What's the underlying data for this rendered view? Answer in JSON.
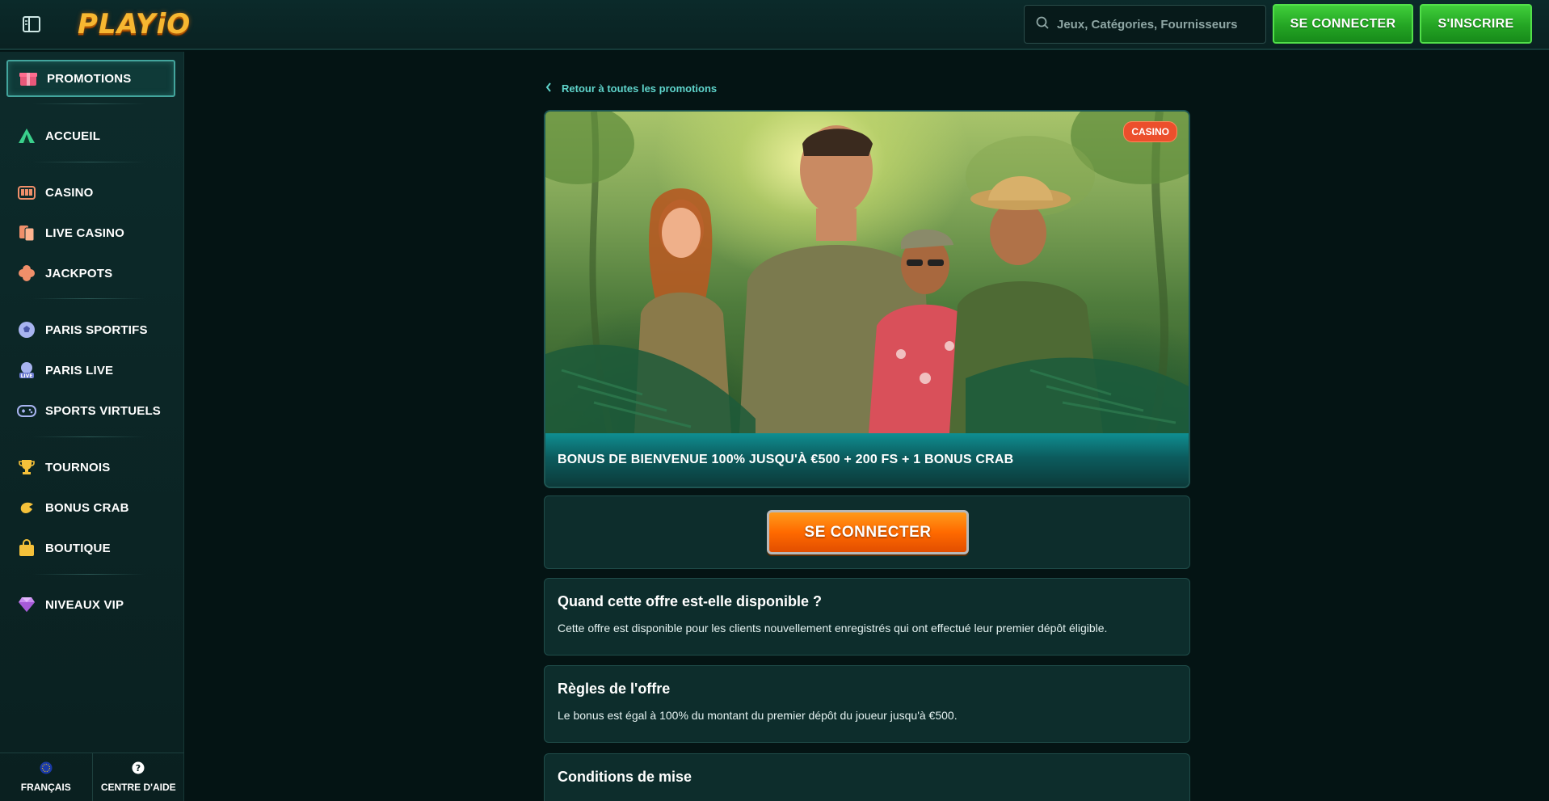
{
  "header": {
    "logo": "PLAYiO",
    "search_placeholder": "Jeux, Catégories, Fournisseurs",
    "login_label": "SE CONNECTER",
    "register_label": "S'INSCRIRE"
  },
  "sidebar": {
    "items": [
      {
        "label": "PROMOTIONS",
        "icon": "gift-icon"
      },
      {
        "label": "ACCUEIL",
        "icon": "tent-icon"
      },
      {
        "label": "CASINO",
        "icon": "slot-machine-icon"
      },
      {
        "label": "LIVE CASINO",
        "icon": "cards-icon"
      },
      {
        "label": "JACKPOTS",
        "icon": "clover-icon"
      },
      {
        "label": "PARIS SPORTIFS",
        "icon": "soccer-ball-icon"
      },
      {
        "label": "PARIS LIVE",
        "icon": "live-icon"
      },
      {
        "label": "SPORTS VIRTUELS",
        "icon": "gamepad-icon"
      },
      {
        "label": "TOURNOIS",
        "icon": "trophy-icon"
      },
      {
        "label": "BONUS CRAB",
        "icon": "crab-icon"
      },
      {
        "label": "BOUTIQUE",
        "icon": "shopping-bag-icon"
      },
      {
        "label": "NIVEAUX VIP",
        "icon": "diamond-icon"
      }
    ],
    "footer": {
      "language_label": "FRANÇAIS",
      "help_label": "CENTRE D'AIDE"
    }
  },
  "main": {
    "back_label": "Retour à toutes les promotions",
    "hero": {
      "badge": "CASINO",
      "title": "BONUS DE BIENVENUE 100% JUSQU'À €500 + 200 FS + 1 BONUS CRAB"
    },
    "cta_label": "SE CONNECTER",
    "sections": [
      {
        "title": "Quand cette offre est-elle disponible ?",
        "text": "Cette offre est disponible pour les clients nouvellement enregistrés qui ont effectué leur premier dépôt éligible."
      },
      {
        "title": "Règles de l'offre",
        "text": "Le bonus est égal à 100% du montant du premier dépôt du joueur jusqu'à €500."
      },
      {
        "title": "Conditions de mise",
        "text": ""
      }
    ]
  },
  "colors": {
    "accent_teal": "#5fd4cb",
    "green_button": "#24a524",
    "orange_button": "#ff6a00",
    "badge_red": "#ec4f2c"
  }
}
